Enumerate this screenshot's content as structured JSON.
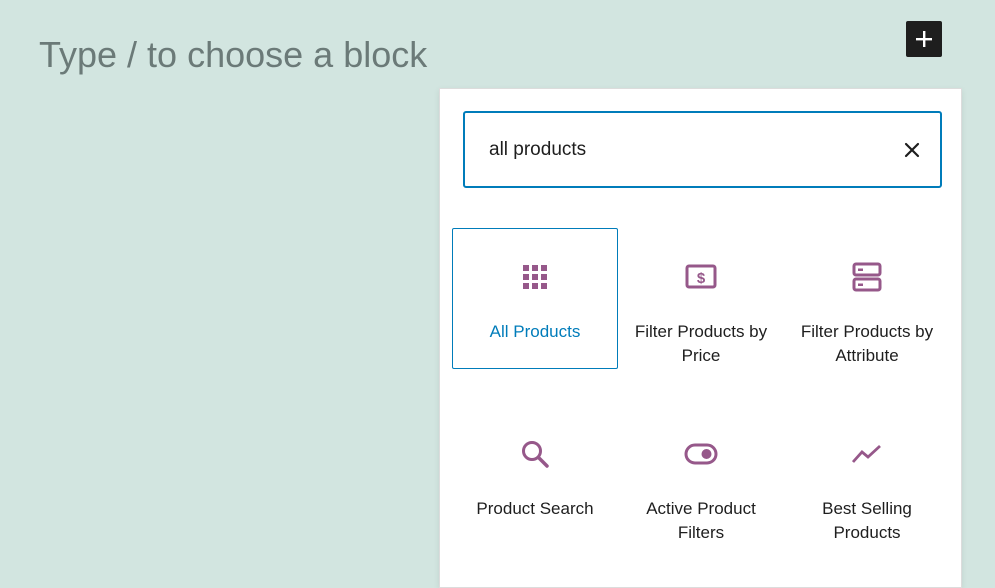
{
  "editor": {
    "placeholder": "Type / to choose a block"
  },
  "toolbar": {
    "add_icon": "plus-icon"
  },
  "inserter": {
    "search": {
      "value": "all products",
      "clear_icon": "close-icon"
    },
    "blocks": [
      {
        "label": "All Products",
        "icon": "grid-icon",
        "selected": true
      },
      {
        "label": "Filter Products by Price",
        "icon": "money-icon",
        "selected": false
      },
      {
        "label": "Filter Products by Attribute",
        "icon": "server-icon",
        "selected": false
      },
      {
        "label": "Product Search",
        "icon": "search-icon",
        "selected": false
      },
      {
        "label": "Active Product Filters",
        "icon": "toggle-icon",
        "selected": false
      },
      {
        "label": "Best Selling Products",
        "icon": "trending-icon",
        "selected": false
      }
    ]
  },
  "colors": {
    "background": "#d2e5e0",
    "accent": "#007cba",
    "icon": "#96588a",
    "text": "#1e1e1e"
  }
}
